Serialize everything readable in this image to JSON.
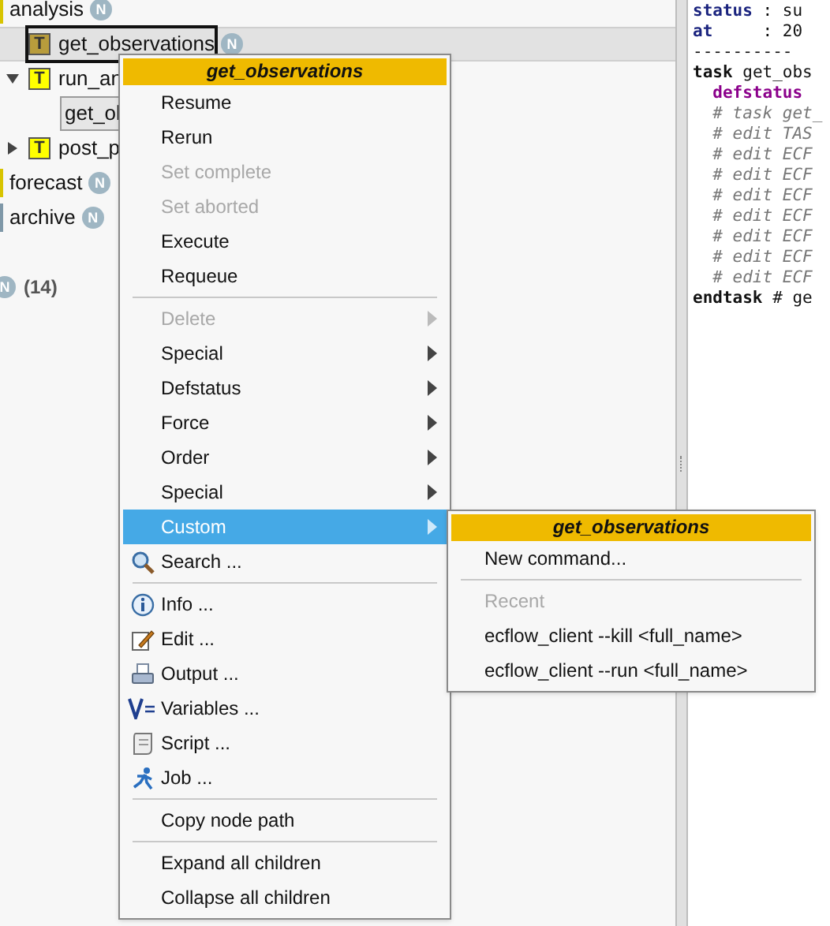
{
  "tree": [
    {
      "label": "analysis",
      "kind": "family",
      "color": "#d8c400",
      "badge": "N",
      "children": [
        {
          "label": "get_observations",
          "kind": "task",
          "type_letter": "T",
          "selected": true,
          "badge": "N"
        },
        {
          "label": "run_an",
          "kind": "task",
          "type_letter": "T",
          "selected": false,
          "expanded": true,
          "children": [
            {
              "label": "get_ol",
              "kind": "alias",
              "selected": false
            }
          ]
        },
        {
          "label": "post_p",
          "kind": "task",
          "type_letter": "T",
          "selected": false,
          "expanded": false
        }
      ]
    },
    {
      "label": "forecast",
      "kind": "family",
      "color": "#d8c400",
      "badge": "N"
    },
    {
      "label": "archive",
      "kind": "family",
      "color": "#7f98a8",
      "badge": "N"
    }
  ],
  "tree_footer": {
    "badge": "N",
    "count": "(14)"
  },
  "code": [
    {
      "kind": "field",
      "key": "status",
      "value": " : su"
    },
    {
      "kind": "field",
      "key": "at",
      "value": "     : 20"
    },
    {
      "kind": "plain",
      "value": "----------"
    },
    {
      "kind": "keyword",
      "key": "task",
      "value": " get_obs"
    },
    {
      "kind": "attribute",
      "key": "  defstatus"
    },
    {
      "kind": "comment",
      "value": "  # task get_"
    },
    {
      "kind": "comment",
      "value": "  # edit TAS"
    },
    {
      "kind": "comment",
      "value": "  # edit ECF"
    },
    {
      "kind": "comment",
      "value": "  # edit ECF"
    },
    {
      "kind": "comment",
      "value": "  # edit ECF"
    },
    {
      "kind": "comment",
      "value": "  # edit ECF"
    },
    {
      "kind": "comment",
      "value": "  # edit ECF"
    },
    {
      "kind": "comment",
      "value": "  # edit ECF"
    },
    {
      "kind": "comment",
      "value": "  # edit ECF"
    },
    {
      "kind": "keyword",
      "key": "endtask",
      "value": " # ge"
    }
  ],
  "context_menu": {
    "title": "get_observations",
    "items": [
      {
        "kind": "item",
        "label": "Resume",
        "disabled": false
      },
      {
        "kind": "item",
        "label": "Rerun",
        "disabled": false
      },
      {
        "kind": "item",
        "label": "Set complete",
        "disabled": true
      },
      {
        "kind": "item",
        "label": "Set aborted",
        "disabled": true
      },
      {
        "kind": "item",
        "label": "Execute",
        "disabled": false
      },
      {
        "kind": "item",
        "label": "Requeue",
        "disabled": false
      },
      {
        "kind": "separator"
      },
      {
        "kind": "submenu",
        "label": "Delete",
        "disabled": true,
        "selected": false
      },
      {
        "kind": "submenu",
        "label": "Special",
        "disabled": false,
        "selected": false
      },
      {
        "kind": "submenu",
        "label": "Defstatus",
        "disabled": false,
        "selected": false
      },
      {
        "kind": "submenu",
        "label": "Force",
        "disabled": false,
        "selected": false
      },
      {
        "kind": "submenu",
        "label": "Order",
        "disabled": false,
        "selected": false
      },
      {
        "kind": "submenu",
        "label": "Special",
        "disabled": false,
        "selected": false
      },
      {
        "kind": "submenu",
        "label": "Custom",
        "disabled": false,
        "selected": true
      },
      {
        "kind": "icon",
        "label": "Search ...",
        "disabled": false
      },
      {
        "kind": "separator"
      },
      {
        "kind": "icon",
        "label": "Info ...",
        "disabled": false
      },
      {
        "kind": "icon",
        "label": "Edit ...",
        "disabled": false
      },
      {
        "kind": "icon",
        "label": "Output ...",
        "disabled": false
      },
      {
        "kind": "icon",
        "label": "Variables ...",
        "disabled": false
      },
      {
        "kind": "icon",
        "label": "Script ...",
        "disabled": false
      },
      {
        "kind": "icon",
        "label": "Job ...",
        "disabled": false
      },
      {
        "kind": "separator"
      },
      {
        "kind": "item",
        "label": "Copy node path",
        "disabled": false
      },
      {
        "kind": "separator"
      },
      {
        "kind": "item",
        "label": "Expand all children",
        "disabled": false
      },
      {
        "kind": "item",
        "label": "Collapse all children",
        "disabled": false
      }
    ]
  },
  "submenu": {
    "title": "get_observations",
    "items": [
      {
        "kind": "item",
        "label": "New command...",
        "disabled": false
      },
      {
        "kind": "separator"
      },
      {
        "kind": "item",
        "label": "Recent",
        "disabled": true
      },
      {
        "kind": "item",
        "label": "ecflow_client --kill  <full_name>",
        "disabled": false
      },
      {
        "kind": "item",
        "label": "ecflow_client --run  <full_name>",
        "disabled": false
      }
    ]
  }
}
